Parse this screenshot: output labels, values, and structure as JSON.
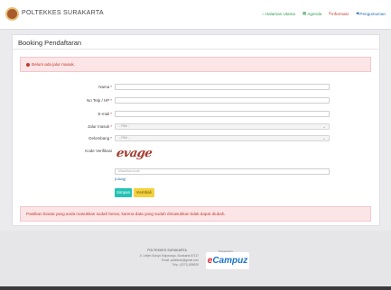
{
  "header": {
    "brand": "POLTEKKES SURAKARTA",
    "nav": [
      {
        "label": "Halaman Utama",
        "icon": "home-icon"
      },
      {
        "label": "Agenda",
        "icon": "calendar-icon"
      },
      {
        "label": "Informasi",
        "icon": "info-icon"
      },
      {
        "label": "Pengumuman",
        "icon": "megaphone-icon"
      }
    ]
  },
  "card": {
    "title": "Booking Pendaftaran",
    "alert_top": "Belum ada jalur masuk.",
    "alert_bottom": "Pastikan bioata yang anda masukkan sudah benar, karena data yang sudah dimasukkan tidak dapat diubah."
  },
  "form": {
    "name_label": "Nama",
    "phone_label": "No Telp / HP",
    "email_label": "E-mail",
    "jalur_label": "Jalur masuk",
    "jalur_value": "- Pilih -",
    "gelombang_label": "Gelombang",
    "gelombang_value": "- Pilih -",
    "verification_label": "Kode Verifikasi",
    "captcha_text": "evage",
    "captcha_placeholder": "Masukkan kode",
    "reload_label": "[Ulang]",
    "save_label": "Simpan",
    "back_label": "Kembali"
  },
  "footer": {
    "name": "POLTEKKES SURAKARTA",
    "address": "Jl. Letjen Sutoyo Mojosongo, Surakarta 57127",
    "email": "Email: poltekkes@gmail.com",
    "phone": "Telp.: (0271) 856929",
    "powered": "Powered by",
    "ecampuz_e": "e",
    "ecampuz_rest": "Campuz"
  }
}
